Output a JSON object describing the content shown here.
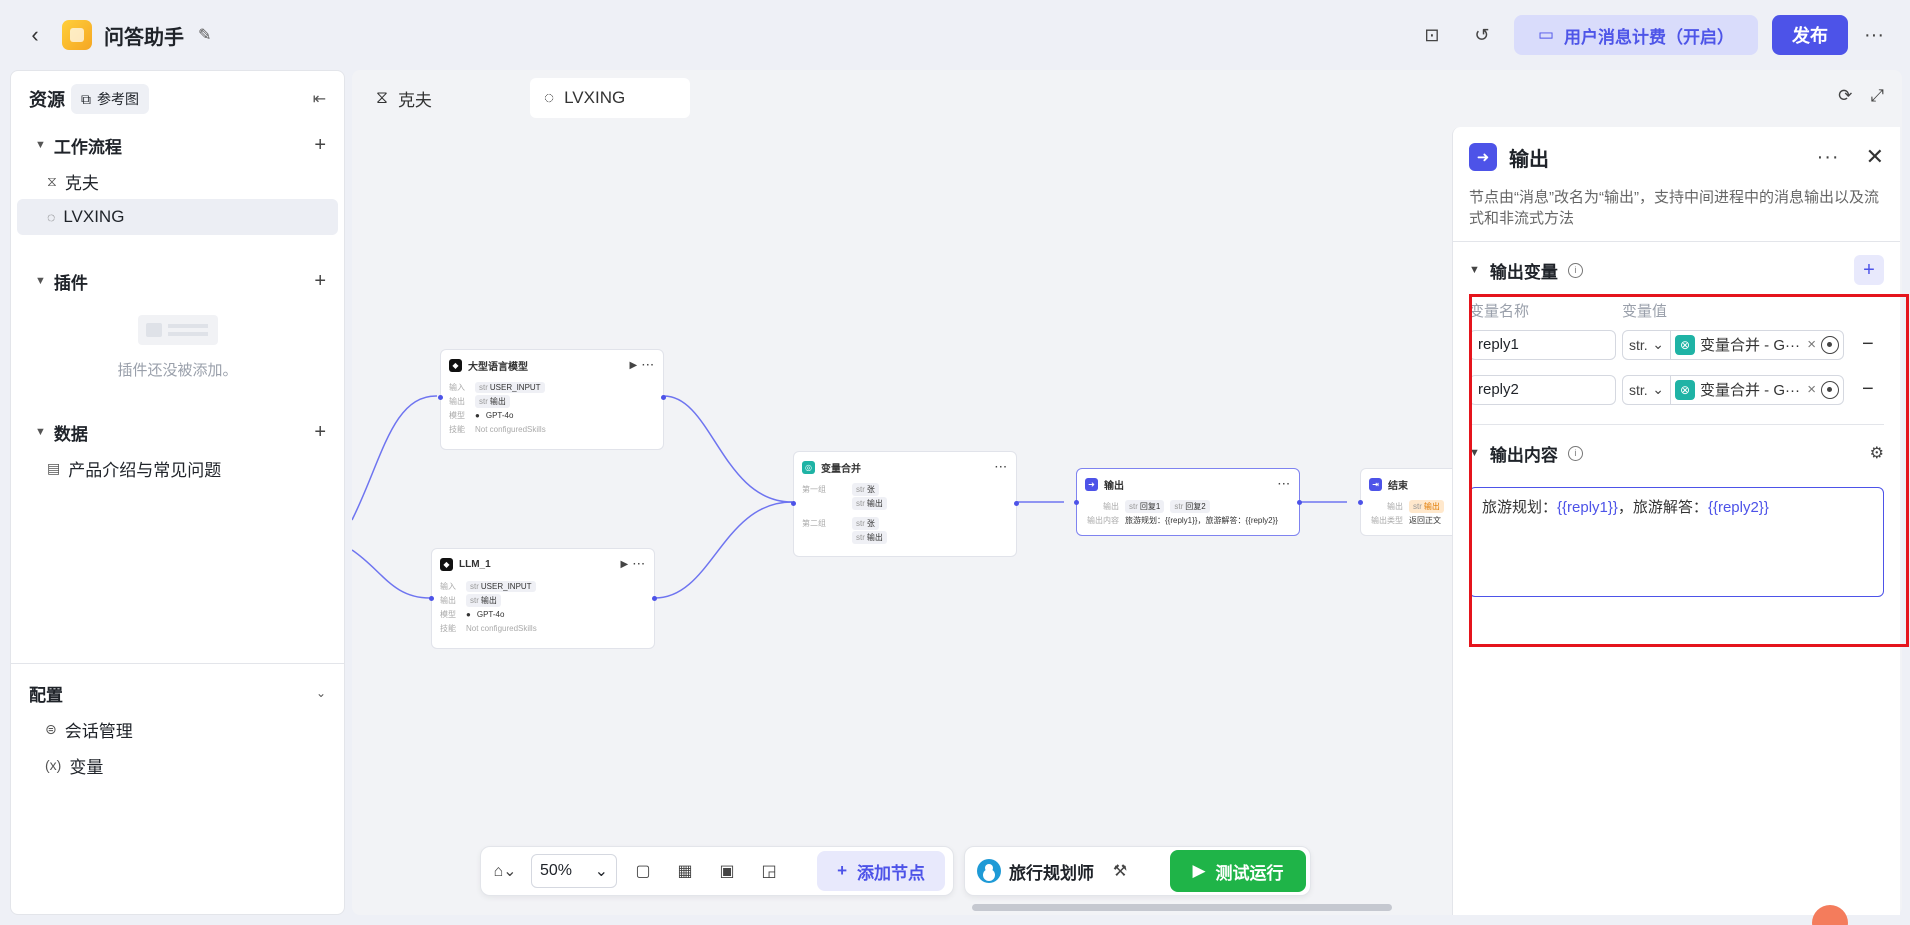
{
  "header": {
    "app_title": "问答助手",
    "billing_label": "用户消息计费（开启）",
    "publish_label": "发布"
  },
  "sidebar": {
    "title": "资源",
    "ref_chip": "参考图",
    "workflow": {
      "title": "工作流程",
      "items": [
        {
          "label": "克夫",
          "icon": "workflow-icon"
        },
        {
          "label": "LVXING",
          "icon": "chat-icon"
        }
      ]
    },
    "plugins": {
      "title": "插件",
      "empty_text": "插件还没被添加。"
    },
    "data": {
      "title": "数据",
      "items": [
        {
          "label": "产品介绍与常见问题",
          "icon": "document-icon"
        }
      ]
    },
    "config": {
      "title": "配置",
      "items": [
        {
          "label": "会话管理",
          "icon": "session-icon"
        },
        {
          "label": "变量",
          "icon": "variable-icon"
        }
      ]
    }
  },
  "canvas": {
    "tabs": [
      {
        "label": "克夫"
      },
      {
        "label": "LVXING"
      }
    ],
    "nodes": {
      "llm_big": {
        "title": "大型语言模型",
        "in_key": "输入",
        "in_val": "USER_INPUT",
        "out_key": "输出",
        "out_val": "输出",
        "model_key": "模型",
        "model_val": "GPT-4o",
        "skill_key": "技能",
        "skill_val": "Not configuredSkills"
      },
      "llm_1": {
        "title": "LLM_1",
        "in_key": "输入",
        "in_val": "USER_INPUT",
        "out_key": "输出",
        "out_val": "输出",
        "model_key": "模型",
        "model_val": "GPT-4o",
        "skill_key": "技能",
        "skill_val": "Not configuredSkills"
      },
      "merge": {
        "title": "变量合并",
        "g1_key": "第一组",
        "g1_v1": "张",
        "g1_v2": "输出",
        "g2_key": "第二组",
        "g2_v1": "张",
        "g2_v2": "输出"
      },
      "output": {
        "title": "输出",
        "out_key": "输出",
        "out_v1": "回复1",
        "out_v2": "回复2",
        "content_key": "输出内容",
        "content_val": "旅游规划：{{reply1}}，旅游解答：{{reply2}}"
      },
      "end": {
        "title": "结束",
        "out_key": "输出",
        "out_val": "输出",
        "type_key": "输出类型",
        "type_val": "返回正文"
      }
    },
    "type_tag": "str",
    "zoom": "50%",
    "add_node_label": "添加节点",
    "persona": "旅行规划师",
    "test_run_label": "测试运行"
  },
  "panel": {
    "title": "输出",
    "description": "节点由“消息”改名为“输出”，支持中间进程中的消息输出以及流式和非流式方法",
    "vars_section": "输出变量",
    "col_name": "变量名称",
    "col_value": "变量值",
    "vars": [
      {
        "name": "reply1",
        "type": "str.",
        "ref": "变量合并 - G···"
      },
      {
        "name": "reply2",
        "type": "str.",
        "ref": "变量合并 - G···"
      }
    ],
    "content_section": "输出内容",
    "content_prefix1": "旅游规划：",
    "content_tok1": "{{reply1}}",
    "content_prefix2": "，旅游解答：",
    "content_tok2": "{{reply2}}"
  },
  "colors": {
    "accent": "#4d53e8",
    "run_green": "#1fb448",
    "highlight_red": "#e5141c"
  }
}
